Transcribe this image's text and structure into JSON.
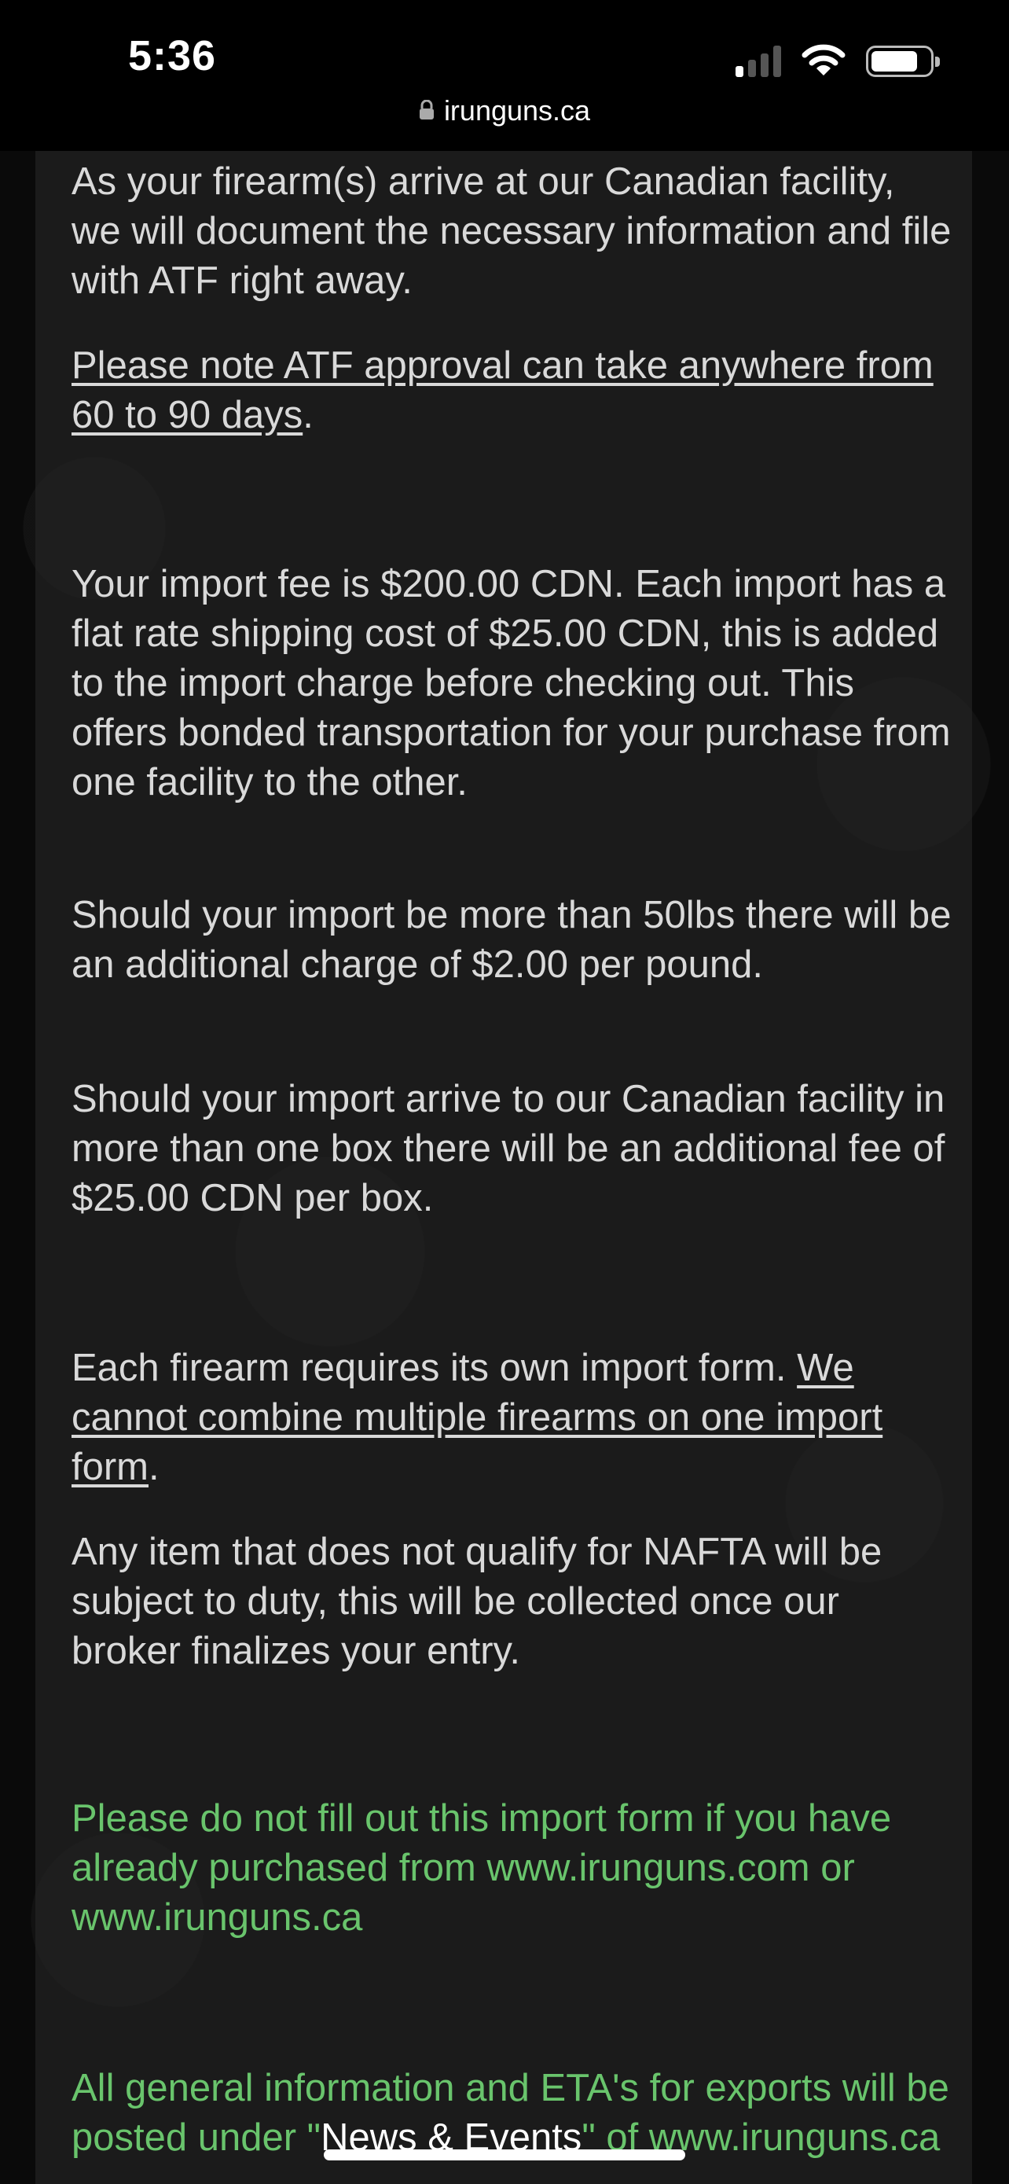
{
  "status_bar": {
    "time": "5:36"
  },
  "url_bar": {
    "domain": "irunguns.ca"
  },
  "content": {
    "p1": "As your firearm(s) arrive at our Canadian facility, we will document the necessary information and file with ATF right away.",
    "p2_link": "Please note ATF approval can take anywhere from 60 to 90 days",
    "p2_tail": ".",
    "p3": "Your import fee is $200.00 CDN.  Each import has a flat rate shipping cost of $25.00 CDN, this is added to the import charge before checking out. This offers bonded transportation for your purchase from one facility to the other.",
    "p4": "Should your import be more than 50lbs there will be an additional charge of $2.00 per pound.",
    "p5": "Should your import arrive to our Canadian facility in more than one box there will be an additional fee of $25.00 CDN per box.",
    "p6_text": "Each firearm requires its own import form. ",
    "p6_link": "We cannot combine multiple firearms on one import form",
    "p6_tail": ".",
    "p7": "Any item that does not qualify for NAFTA will be subject to duty, this will be collected once our broker finalizes your entry.",
    "p8": "Please do not fill out this import form if you have already purchased from www.irunguns.com or www.irunguns.ca",
    "p9_start": "All general information and ETA's for exports will be posted under \"",
    "p9_link": "News & Events",
    "p9_end": "\" of www.irunguns.ca"
  },
  "colors": {
    "body_text": "#d9d9d9",
    "notice_text": "#69c46c",
    "background": "#0a0a0a"
  },
  "icons": [
    "signal-icon",
    "wifi-icon",
    "battery-icon",
    "lock-icon"
  ]
}
